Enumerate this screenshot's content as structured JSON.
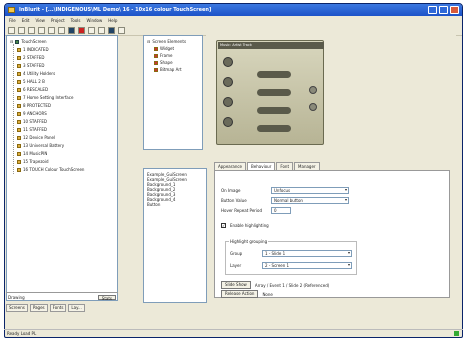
{
  "window": {
    "title": "InBlurit - [...\\INDIGENOUS\\ML Demo\\ 16 - 10x16 colour TouchScreen]"
  },
  "menu": [
    "File",
    "Edit",
    "View",
    "Project",
    "Tools",
    "Window",
    "Help"
  ],
  "tree": {
    "root": "TouchScreen",
    "items": [
      "1 INDICATED",
      "2 STAFFED",
      "3 STAFFED",
      "4 Utility Holders",
      "5 HALL 2 B",
      "6 RESCALED",
      "7 Home Setting Interface",
      "8 PROTECTED",
      "9 ANCHORS",
      "10 STAFFED",
      "11 STAFFED",
      "12 Device Panel",
      "13 Universal Battery",
      "14 MusicPIN",
      "15 Trapezoid",
      "16 TOUCH Colour TouchScreen"
    ],
    "footer_left": "Drawing",
    "footer_right": "Stats"
  },
  "bottom_tabs": [
    "Screens",
    "Pages",
    "Fonts",
    "Lay..."
  ],
  "layers": {
    "root": "Screen Elements",
    "items": [
      "Widget",
      "Frame",
      "Shape",
      "Bitmap Art"
    ]
  },
  "device": {
    "header": "Music: Artist Track"
  },
  "list": {
    "items": [
      "Example_GuiScreen",
      "Example_GuiScreen",
      "Background_1",
      "Background_2",
      "Background_3",
      "Background_4",
      "Button"
    ]
  },
  "props": {
    "tabs": [
      "Appearance",
      "Behaviour",
      "Font",
      "Manager"
    ],
    "active_tab": "Behaviour",
    "rows": [
      {
        "label": "On Image",
        "value": "Unfocus"
      },
      {
        "label": "Button Value",
        "value": "Normal button"
      },
      {
        "label": "Hover Repeat Period",
        "value": "0"
      }
    ],
    "enable_label": "Enable highlighting",
    "group_title": "Highlight grouping",
    "group_rows": [
      {
        "label": "Group",
        "value": "1 - Slide 1"
      },
      {
        "label": "Layer",
        "value": "2 - Screen 1"
      }
    ],
    "button1": "Slide Show",
    "button1_text": "Array / Event 1 / Slide 2 (Referenced)",
    "button2": "Release Action",
    "button2_text": "None"
  },
  "status": "Ready  Load PL"
}
